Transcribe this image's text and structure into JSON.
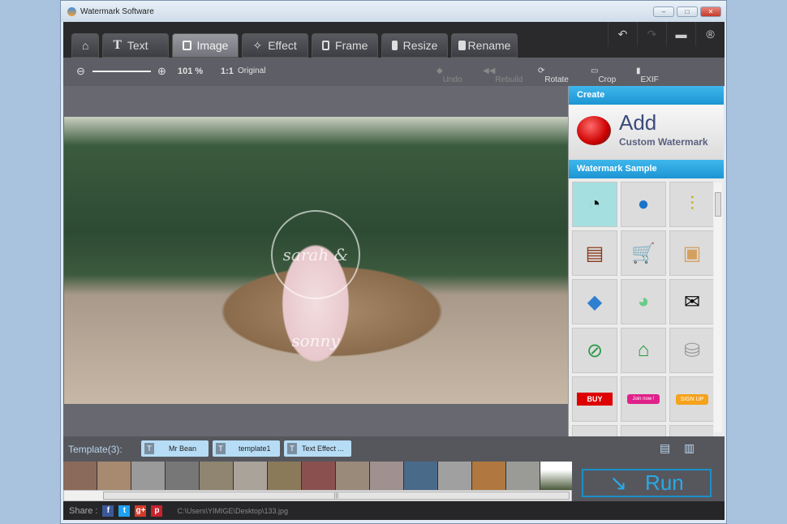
{
  "window": {
    "title": "Watermark Software"
  },
  "tabs": [
    {
      "label": "",
      "icon": "home-icon"
    },
    {
      "label": "Text",
      "icon": "text-icon"
    },
    {
      "label": "Image",
      "icon": "image-icon",
      "active": true
    },
    {
      "label": "Effect",
      "icon": "magic-wand-icon"
    },
    {
      "label": "Frame",
      "icon": "frame-icon"
    },
    {
      "label": "Resize",
      "icon": "resize-icon"
    },
    {
      "label": "Rename",
      "icon": "rename-icon"
    }
  ],
  "subbar": {
    "zoom": "101 %",
    "original": "Original",
    "undo": "Undo",
    "rebuild": "Rebuild",
    "rotate": "Rotate",
    "crop": "Crop",
    "exif": "EXIF"
  },
  "image": {
    "watermark_text": "sarah & sonny"
  },
  "panel": {
    "create": "Create",
    "add": "Add",
    "add_sub": "Custom Watermark",
    "sample": "Watermark Sample",
    "buy": "BUY",
    "join": "Join now !",
    "signup": "SIGN UP"
  },
  "templates": {
    "label": "Template(3):",
    "items": [
      "Mr Bean",
      "template1",
      "Text Effect ..."
    ]
  },
  "run": "Run",
  "status": {
    "share": "Share :",
    "path": "C:\\Users\\YIMIGE\\Desktop\\133.jpg"
  },
  "colors": {
    "accent": "#1c95d3",
    "run": "#2aa9e6"
  }
}
